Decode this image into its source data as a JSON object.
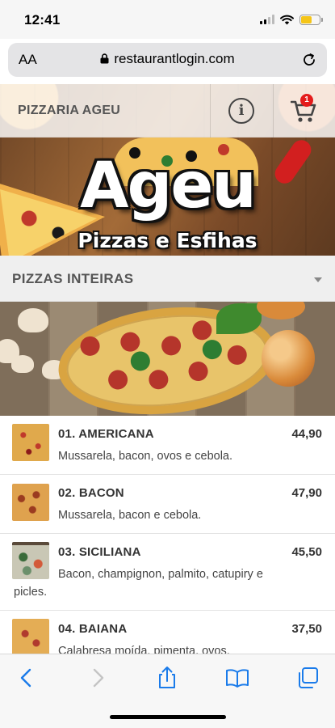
{
  "status_bar": {
    "time": "12:41"
  },
  "browser": {
    "text_size_label": "AA",
    "url": "restaurantlogin.com"
  },
  "header": {
    "restaurant_name": "PIZZARIA AGEU",
    "cart_count": "1"
  },
  "banner": {
    "logo_title": "Ageu",
    "logo_subtitle": "Pizzas e Esfihas"
  },
  "category": {
    "selected": "PIZZAS INTEIRAS"
  },
  "products": [
    {
      "name": "01. AMERICANA",
      "price": "44,90",
      "description": "Mussarela, bacon, ovos e cebola."
    },
    {
      "name": "02. BACON",
      "price": "47,90",
      "description": "Mussarela, bacon e cebola."
    },
    {
      "name": "03. SICILIANA",
      "price": "45,50",
      "description_line1": "Bacon, champignon, palmito, catupiry e",
      "description_line2": "picles."
    },
    {
      "name": "04. BAIANA",
      "price": "37,50",
      "description": "Calabresa moída, pimenta, ovos,"
    }
  ],
  "colors": {
    "accent_blue": "#1a7bea",
    "badge_red": "#e41b1b",
    "battery_yellow": "#f5c518"
  }
}
